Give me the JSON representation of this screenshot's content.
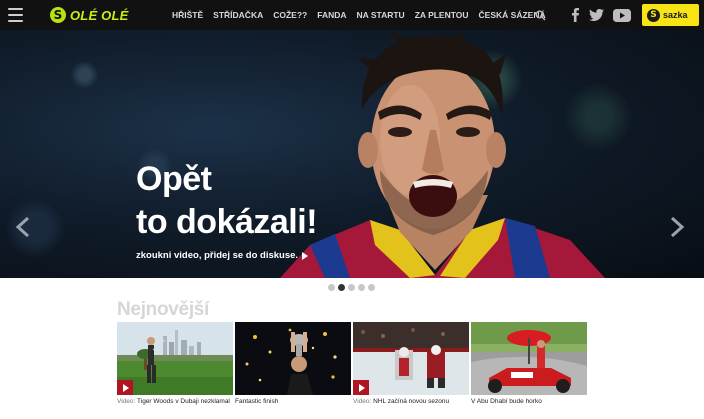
{
  "nav": {
    "logo_mark": "S",
    "logo_text": "OLÉ OLÉ",
    "menu": [
      "HŘIŠTĚ",
      "STŘÍDAČKA",
      "COŽE??",
      "FANDA",
      "NA STARTU",
      "ZA PLENTOU",
      "ČESKÁ SÁZENÁ"
    ],
    "search_icon": "search-icon",
    "social": [
      "facebook-icon",
      "twitter-icon",
      "youtube-icon"
    ],
    "sazka_mark": "S",
    "sazka_text": "sazka"
  },
  "hero": {
    "title_line1": "Opět",
    "title_line2": "to dokázali!",
    "subtitle": "zkoukni video, přidej se do diskuse."
  },
  "slider": {
    "count": 5,
    "active_index": 1
  },
  "latest": {
    "title": "Nejnovější",
    "items": [
      {
        "prefix": "Video:",
        "text": "Tiger Woods v Dubaji nezklamal",
        "has_play": true
      },
      {
        "prefix": "",
        "text": "Fantastic finish",
        "has_play": false
      },
      {
        "prefix": "Video:",
        "text": "NHL začíná novou sezonu",
        "has_play": true
      },
      {
        "prefix": "",
        "text": "V Abu Dhabí bude horko",
        "has_play": false
      }
    ]
  },
  "colors": {
    "nav_bg": "#111111",
    "logo_green": "#c6ef12",
    "sazka_yellow": "#f7e414",
    "play_red": "#b01621"
  }
}
